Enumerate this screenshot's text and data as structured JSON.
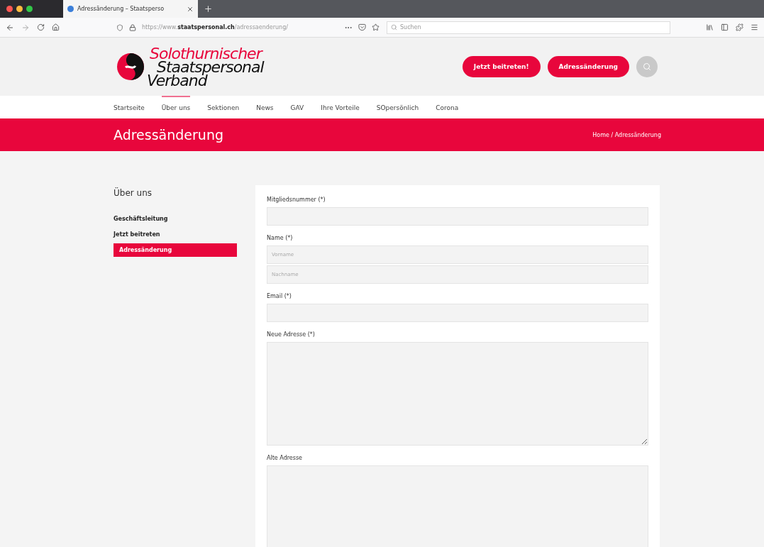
{
  "browser": {
    "tab_title": "Adressänderung – Staatsperso",
    "url_prefix": "https://www.",
    "url_host": "staatspersonal.ch",
    "url_path": "/adressaenderung/",
    "search": {
      "placeholder": "Suchen"
    }
  },
  "header": {
    "logo": {
      "line_1": "Solothurnischer",
      "line_2": "Staatspersonal",
      "line_3": "Verband"
    },
    "buttons": [
      "Jetzt beitreten!",
      "Adressänderung"
    ]
  },
  "nav": [
    {
      "label": "Startseite",
      "selected": false
    },
    {
      "label": "Über uns",
      "selected": true
    },
    {
      "label": "Sektionen",
      "selected": false
    },
    {
      "label": "News",
      "selected": false
    },
    {
      "label": "GAV",
      "selected": false
    },
    {
      "label": "Ihre Vorteile",
      "selected": false
    },
    {
      "label": "SOpersönlich",
      "selected": false
    },
    {
      "label": "Corona",
      "selected": false
    }
  ],
  "banner": {
    "title": "Adressänderung",
    "breadcrumb": "Home / Adressänderung"
  },
  "sidebar": {
    "title": "Über uns",
    "items": [
      {
        "label": "Geschäftsleitung",
        "selected": false
      },
      {
        "label": "Jetzt beitreten",
        "selected": false
      },
      {
        "label": "Adressänderung",
        "selected": true
      }
    ]
  },
  "form": {
    "fields": [
      {
        "kind": "input",
        "label": "Mitgliedsnummer (*)"
      },
      {
        "kind": "pair",
        "label": "Name (*)",
        "placeholders": [
          "Vorname",
          "Nachname"
        ]
      },
      {
        "kind": "input",
        "label": "Email (*)"
      },
      {
        "kind": "textarea",
        "label": "Neue Adresse (*)"
      },
      {
        "kind": "textarea",
        "label": "Alte Adresse"
      }
    ]
  }
}
